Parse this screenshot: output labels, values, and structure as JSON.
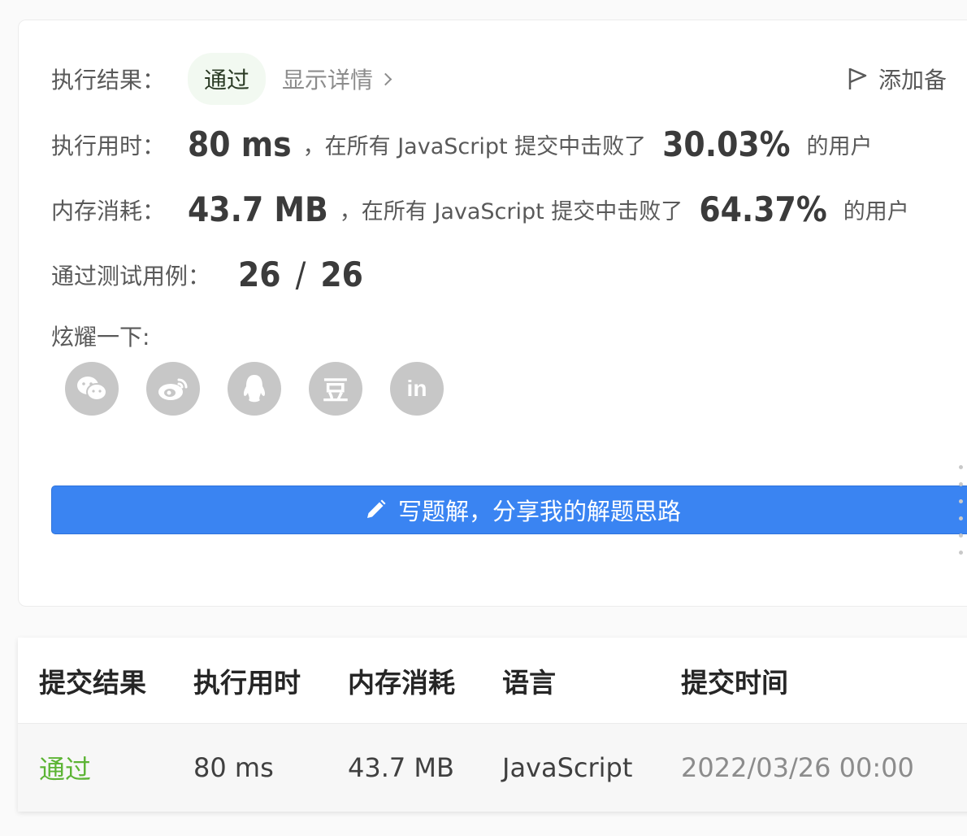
{
  "result": {
    "label": "执行结果：",
    "status": "通过",
    "details_link": "显示详情",
    "add_note": "添加备"
  },
  "runtime": {
    "label": "执行用时：",
    "value": "80 ms",
    "middle": "，在所有 JavaScript 提交中击败了",
    "percent": "30.03%",
    "suffix": "的用户"
  },
  "memory": {
    "label": "内存消耗：",
    "value": "43.7 MB",
    "middle": "，在所有 JavaScript 提交中击败了",
    "percent": "64.37%",
    "suffix": "的用户"
  },
  "tests": {
    "label": "通过测试用例：",
    "passed": "26",
    "separator": "/",
    "total": "26"
  },
  "share": {
    "label": "炫耀一下:",
    "icons": [
      "wechat-icon",
      "weibo-icon",
      "qq-icon",
      "douban-icon",
      "linkedin-icon"
    ],
    "douban_glyph": "豆",
    "linkedin_glyph": "in"
  },
  "write_solution": {
    "label": "写题解，分享我的解题思路"
  },
  "table": {
    "headers": [
      "提交结果",
      "执行用时",
      "内存消耗",
      "语言",
      "提交时间"
    ],
    "rows": [
      [
        "通过",
        "80 ms",
        "43.7 MB",
        "JavaScript",
        "2022/03/26 00:00"
      ]
    ]
  },
  "colors": {
    "accent": "#3a84f2",
    "success": "#5cb434",
    "icon_gray": "#c7c7c7"
  }
}
